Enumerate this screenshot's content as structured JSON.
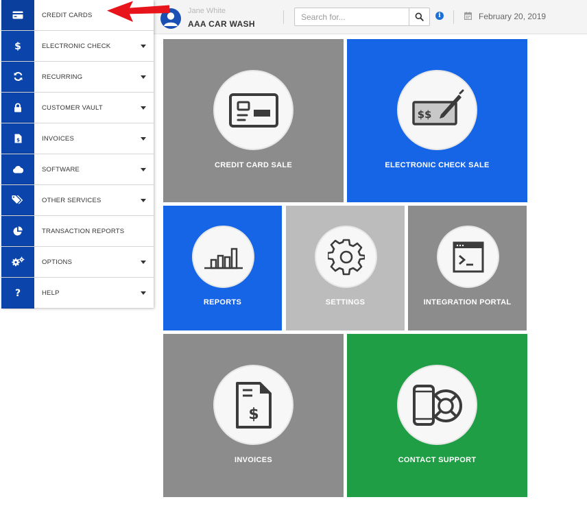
{
  "header": {
    "user_name": "Jane White",
    "company": "AAA CAR WASH",
    "search_placeholder": "Search for...",
    "date": "February 20, 2019"
  },
  "sidebar": {
    "items": [
      {
        "label": "CREDIT CARDS",
        "icon": "credit-card-icon",
        "has_caret": false
      },
      {
        "label": "ELECTRONIC CHECK",
        "icon": "dollar-icon",
        "has_caret": true
      },
      {
        "label": "RECURRING",
        "icon": "refresh-icon",
        "has_caret": true
      },
      {
        "label": "CUSTOMER VAULT",
        "icon": "lock-icon",
        "has_caret": true
      },
      {
        "label": "INVOICES",
        "icon": "invoice-file-icon",
        "has_caret": true
      },
      {
        "label": "SOFTWARE",
        "icon": "cloud-icon",
        "has_caret": true
      },
      {
        "label": "OTHER SERVICES",
        "icon": "tags-icon",
        "has_caret": true
      },
      {
        "label": "TRANSACTION REPORTS",
        "icon": "pie-chart-icon",
        "has_caret": false
      },
      {
        "label": "OPTIONS",
        "icon": "gears-icon",
        "has_caret": true
      },
      {
        "label": "HELP",
        "icon": "question-icon",
        "has_caret": true
      }
    ]
  },
  "tiles": {
    "credit_card_sale": {
      "label": "CREDIT CARD SALE",
      "icon": "credit-card-icon",
      "color": "#8c8c8c"
    },
    "electronic_check_sale": {
      "label": "ELECTRONIC CHECK SALE",
      "icon": "check-pen-icon",
      "color": "#1565e6"
    },
    "reports": {
      "label": "REPORTS",
      "icon": "bar-chart-icon",
      "color": "#1565e6"
    },
    "settings": {
      "label": "SETTINGS",
      "icon": "gear-icon",
      "color": "#bcbcbc"
    },
    "integration_portal": {
      "label": "INTEGRATION PORTAL",
      "icon": "terminal-window-icon",
      "color": "#8c8c8c"
    },
    "invoices": {
      "label": "INVOICES",
      "icon": "invoice-dollar-icon",
      "color": "#8c8c8c"
    },
    "contact_support": {
      "label": "CONTACT SUPPORT",
      "icon": "phone-lifebuoy-icon",
      "color": "#1f9e45"
    }
  },
  "colors": {
    "sidebar_icon_bg": "#0b45ab",
    "annotation_arrow": "#e8141c"
  }
}
